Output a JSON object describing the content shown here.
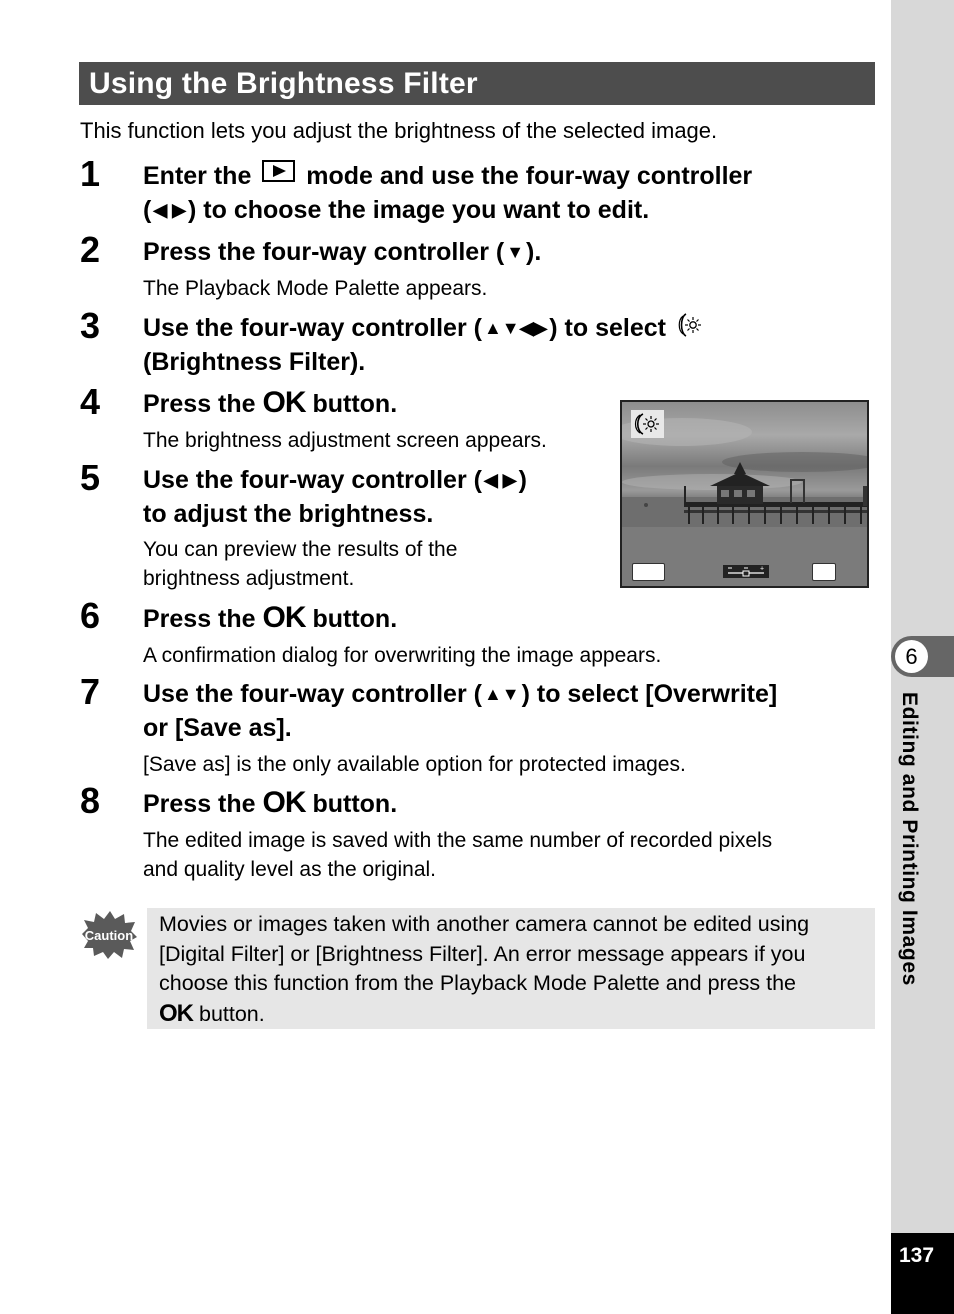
{
  "section": {
    "title": "Using the Brightness Filter",
    "intro": "This function lets you adjust the brightness of the selected image."
  },
  "steps": [
    {
      "number": "1",
      "head_parts": [
        "Enter the",
        "mode and use the four-way controller",
        "(",
        "◀ ▶",
        ") to choose the image you want to edit."
      ],
      "icon": "playback-mode-icon"
    },
    {
      "number": "2",
      "head_parts": [
        "Press the four-way controller (",
        "▼",
        ")."
      ],
      "desc": "The Playback Mode Palette appears."
    },
    {
      "number": "3",
      "head_parts": [
        "Use the four-way controller (",
        "▲▼◀▶",
        ") to select",
        "(Brightness Filter)."
      ],
      "icon": "brightness-filter-icon"
    },
    {
      "number": "4",
      "head_parts": [
        "Press the",
        "OK",
        "button."
      ],
      "desc": "The brightness adjustment screen appears."
    },
    {
      "number": "5",
      "head_parts": [
        "Use the four-way controller (",
        "◀ ▶",
        ")",
        "to adjust the brightness."
      ],
      "desc_lines": [
        "You can preview the results of the",
        "brightness adjustment."
      ]
    },
    {
      "number": "6",
      "head_parts": [
        "Press the",
        "OK",
        "button."
      ],
      "desc": "A confirmation dialog for overwriting the image appears."
    },
    {
      "number": "7",
      "head_parts": [
        "Use the four-way controller (",
        "▲▼",
        ") to select [Overwrite]",
        "or [Save as]."
      ],
      "desc": "[Save as] is the only available option for protected images."
    },
    {
      "number": "8",
      "head_parts": [
        "Press the",
        "OK",
        "button."
      ],
      "desc_lines": [
        "The edited image is saved with the same number of recorded pixels",
        "and quality level as the original."
      ]
    }
  ],
  "screen": {
    "icon": "brightness-filter-icon",
    "slider": {
      "min_label": "–",
      "mid_label": "–",
      "max_label": "+",
      "value_fraction": 0.5
    }
  },
  "caution": {
    "icon_label": "Caution",
    "lines": [
      "Movies or images taken with another camera cannot be edited using",
      "[Digital Filter] or [Brightness Filter]. An error message appears if you",
      "choose this function from the Playback Mode Palette and press the"
    ],
    "ok_label": "OK",
    "last_line_suffix": "button."
  },
  "sidebar": {
    "chapter_number": "6",
    "chapter_title": "Editing and Printing Images",
    "page_number": "137"
  },
  "colors": {
    "title_bar": "#4d4d4d",
    "sidebar": "#d8d8d8",
    "chapter_tab": "#666666",
    "caution_box": "#e6e6e6",
    "page_box": "#000000"
  }
}
